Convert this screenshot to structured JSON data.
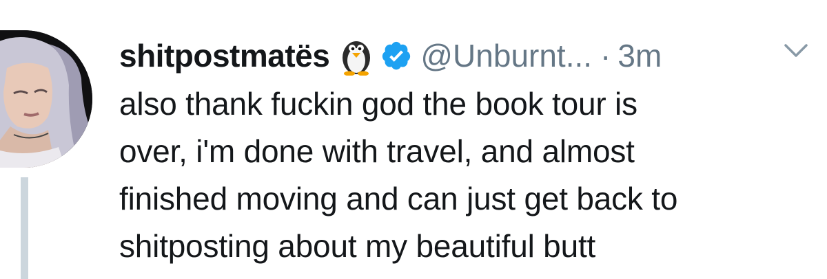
{
  "tweet": {
    "display_name": "shitpostmatës",
    "handle": "@Unburnt...",
    "separator": "·",
    "time": "3m",
    "name_emoji_icon": "penguin-icon",
    "verified_icon": "verified-badge-icon",
    "menu_icon": "chevron-down-icon",
    "text_lines": [
      "also thank fuckin god the book tour is",
      "over, i'm done with travel, and almost",
      "finished moving and can just get back to",
      "shitposting about my beautiful butt"
    ]
  },
  "colors": {
    "text": "#14171a",
    "secondary": "#657786",
    "verified": "#1da1f2",
    "thread_line": "#ccd6dd",
    "background": "#ffffff"
  }
}
